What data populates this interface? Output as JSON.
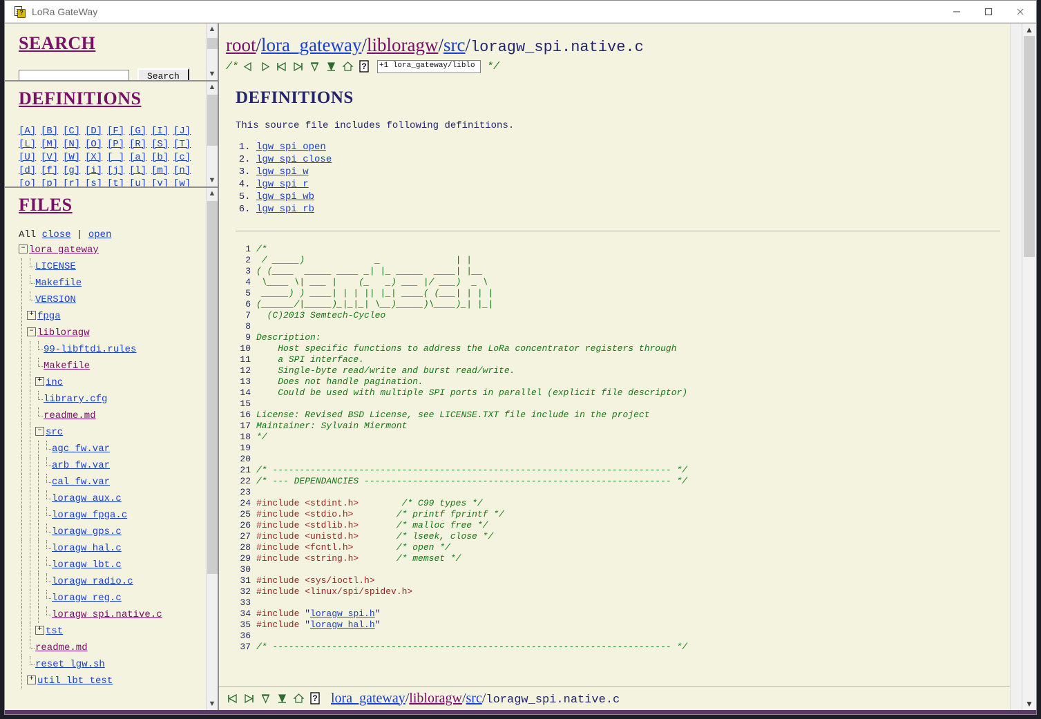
{
  "window": {
    "title": "LoRa GateWay",
    "icon": "document-question-icon",
    "minimize_label": "–",
    "maximize_label": "□",
    "close_label": "✕"
  },
  "search_panel": {
    "heading": "SEARCH",
    "input_value": "",
    "input_placeholder": "",
    "button_label": "Search"
  },
  "definitions_panel": {
    "heading": "DEFINITIONS",
    "alphabet_rows": [
      [
        "[A]",
        "[B]",
        "[C]",
        "[D]",
        "[F]",
        "[G]",
        "[I]",
        "[J]"
      ],
      [
        "[L]",
        "[M]",
        "[N]",
        "[O]",
        "[P]",
        "[R]",
        "[S]",
        "[T]"
      ],
      [
        "[U]",
        "[V]",
        "[W]",
        "[X]",
        "[_]",
        "[a]",
        "[b]",
        "[c]"
      ],
      [
        "[d]",
        "[f]",
        "[g]",
        "[i]",
        "[j]",
        "[l]",
        "[m]",
        "[n]"
      ],
      [
        "[o]",
        "[p]",
        "[r]",
        "[s]",
        "[t]",
        "[u]",
        "[v]",
        "[w]"
      ]
    ]
  },
  "files_panel": {
    "heading": "FILES",
    "all_label": "All",
    "close_label": "close",
    "separator": "|",
    "open_label": "open",
    "tree": [
      {
        "label": "lora_gateway",
        "depth": 0,
        "toggle": "minus",
        "visited": true
      },
      {
        "label": "LICENSE",
        "depth": 1,
        "toggle": "none",
        "visited": false
      },
      {
        "label": "Makefile",
        "depth": 1,
        "toggle": "none",
        "visited": false
      },
      {
        "label": "VERSION",
        "depth": 1,
        "toggle": "none",
        "visited": false
      },
      {
        "label": "fpga",
        "depth": 1,
        "toggle": "plus",
        "visited": false
      },
      {
        "label": "libloragw",
        "depth": 1,
        "toggle": "minus",
        "visited": true
      },
      {
        "label": "99-libftdi.rules",
        "depth": 2,
        "toggle": "none",
        "visited": false
      },
      {
        "label": "Makefile",
        "depth": 2,
        "toggle": "none",
        "visited": true
      },
      {
        "label": "inc",
        "depth": 2,
        "toggle": "plus",
        "visited": false
      },
      {
        "label": "library.cfg",
        "depth": 2,
        "toggle": "none",
        "visited": false
      },
      {
        "label": "readme.md",
        "depth": 2,
        "toggle": "none",
        "visited": true
      },
      {
        "label": "src",
        "depth": 2,
        "toggle": "minus",
        "visited": false
      },
      {
        "label": "agc_fw.var",
        "depth": 3,
        "toggle": "none",
        "visited": false
      },
      {
        "label": "arb_fw.var",
        "depth": 3,
        "toggle": "none",
        "visited": false
      },
      {
        "label": "cal_fw.var",
        "depth": 3,
        "toggle": "none",
        "visited": false
      },
      {
        "label": "loragw_aux.c",
        "depth": 3,
        "toggle": "none",
        "visited": false
      },
      {
        "label": "loragw_fpga.c",
        "depth": 3,
        "toggle": "none",
        "visited": false
      },
      {
        "label": "loragw_gps.c",
        "depth": 3,
        "toggle": "none",
        "visited": false
      },
      {
        "label": "loragw_hal.c",
        "depth": 3,
        "toggle": "none",
        "visited": false
      },
      {
        "label": "loragw_lbt.c",
        "depth": 3,
        "toggle": "none",
        "visited": false
      },
      {
        "label": "loragw_radio.c",
        "depth": 3,
        "toggle": "none",
        "visited": false
      },
      {
        "label": "loragw_reg.c",
        "depth": 3,
        "toggle": "none",
        "visited": false
      },
      {
        "label": "loragw_spi.native.c",
        "depth": 3,
        "toggle": "none",
        "visited": true
      },
      {
        "label": "tst",
        "depth": 2,
        "toggle": "plus",
        "visited": false
      },
      {
        "label": "readme.md",
        "depth": 1,
        "toggle": "none",
        "visited": true
      },
      {
        "label": "reset_lgw.sh",
        "depth": 1,
        "toggle": "none",
        "visited": false
      },
      {
        "label": "util_lbt_test",
        "depth": 1,
        "toggle": "plus",
        "visited": false
      }
    ]
  },
  "breadcrumb": {
    "parts": [
      {
        "text": "root",
        "link": true,
        "visited": true
      },
      {
        "text": "/",
        "link": false,
        "visited": false
      },
      {
        "text": "lora_gateway",
        "link": true,
        "visited": false
      },
      {
        "text": "/",
        "link": false,
        "visited": false
      },
      {
        "text": "libloragw",
        "link": true,
        "visited": true
      },
      {
        "text": "/",
        "link": false,
        "visited": false
      },
      {
        "text": "src",
        "link": true,
        "visited": false
      },
      {
        "text": "/",
        "link": false,
        "visited": false
      }
    ],
    "current": "loragw_spi.native.c"
  },
  "toolbar": {
    "open_comment": "/*",
    "close_comment": "*/",
    "icons": [
      "prev-triangle-icon",
      "next-triangle-icon",
      "first-icon",
      "last-icon",
      "top-icon",
      "bottom-icon",
      "home-icon",
      "help-icon"
    ],
    "quick_field_value": "+1 lora_gateway/liblo"
  },
  "main": {
    "heading": "DEFINITIONS",
    "intro": "This source file includes following definitions.",
    "definition_links": [
      "lgw_spi_open",
      "lgw_spi_close",
      "lgw_spi_w",
      "lgw_spi_r",
      "lgw_spi_wb",
      "lgw_spi_rb"
    ]
  },
  "code": {
    "start_line": 1,
    "lines": [
      {
        "n": 1,
        "segs": [
          {
            "t": "/*",
            "c": "cmt"
          }
        ]
      },
      {
        "n": 2,
        "segs": [
          {
            "t": " / _____)             _              | |",
            "c": "cmt"
          }
        ]
      },
      {
        "n": 3,
        "segs": [
          {
            "t": "( (____  _____ ____ _| |_ _____  ____| |__",
            "c": "cmt"
          }
        ]
      },
      {
        "n": 4,
        "segs": [
          {
            "t": " \\____ \\| ___ |    (_   _) ___ |/ ___)  _ \\",
            "c": "cmt"
          }
        ]
      },
      {
        "n": 5,
        "segs": [
          {
            "t": " _____) ) ____| | | || |_| ____( (___| | | |",
            "c": "cmt"
          }
        ]
      },
      {
        "n": 6,
        "segs": [
          {
            "t": "(______/|_____)_|_|_| \\__)_____)\\____)_| |_|",
            "c": "cmt"
          }
        ]
      },
      {
        "n": 7,
        "segs": [
          {
            "t": "  (C)2013 Semtech-Cycleo",
            "c": "cmt"
          }
        ]
      },
      {
        "n": 8,
        "segs": [
          {
            "t": "",
            "c": "cmt"
          }
        ]
      },
      {
        "n": 9,
        "segs": [
          {
            "t": "Description:",
            "c": "cmt"
          }
        ]
      },
      {
        "n": 10,
        "segs": [
          {
            "t": "    Host specific functions to address the LoRa concentrator registers through",
            "c": "cmt"
          }
        ]
      },
      {
        "n": 11,
        "segs": [
          {
            "t": "    a SPI interface.",
            "c": "cmt"
          }
        ]
      },
      {
        "n": 12,
        "segs": [
          {
            "t": "    Single-byte read/write and burst read/write.",
            "c": "cmt"
          }
        ]
      },
      {
        "n": 13,
        "segs": [
          {
            "t": "    Does not handle pagination.",
            "c": "cmt"
          }
        ]
      },
      {
        "n": 14,
        "segs": [
          {
            "t": "    Could be used with multiple SPI ports in parallel (explicit file descriptor)",
            "c": "cmt"
          }
        ]
      },
      {
        "n": 15,
        "segs": [
          {
            "t": "",
            "c": "cmt"
          }
        ]
      },
      {
        "n": 16,
        "segs": [
          {
            "t": "License: Revised BSD License, see LICENSE.TXT file include in the project",
            "c": "cmt"
          }
        ]
      },
      {
        "n": 17,
        "segs": [
          {
            "t": "Maintainer: Sylvain Miermont",
            "c": "cmt"
          }
        ]
      },
      {
        "n": 18,
        "segs": [
          {
            "t": "*/",
            "c": "cmt"
          }
        ]
      },
      {
        "n": 19,
        "segs": [
          {
            "t": "",
            "c": "cmt"
          }
        ]
      },
      {
        "n": 20,
        "segs": [
          {
            "t": "",
            "c": "cmt"
          }
        ]
      },
      {
        "n": 21,
        "segs": [
          {
            "t": "/* -------------------------------------------------------------------------- */",
            "c": "cmt"
          }
        ]
      },
      {
        "n": 22,
        "segs": [
          {
            "t": "/* --- DEPENDANCIES --------------------------------------------------------- */",
            "c": "cmt"
          }
        ]
      },
      {
        "n": 23,
        "segs": [
          {
            "t": "",
            "c": "cmt"
          }
        ]
      },
      {
        "n": 24,
        "segs": [
          {
            "t": "#include <stdint.h>",
            "c": "pre"
          },
          {
            "t": "        ",
            "c": "str"
          },
          {
            "t": "/* C99 types */",
            "c": "cmt"
          }
        ]
      },
      {
        "n": 25,
        "segs": [
          {
            "t": "#include <stdio.h>",
            "c": "pre"
          },
          {
            "t": "        ",
            "c": "str"
          },
          {
            "t": "/* printf fprintf */",
            "c": "cmt"
          }
        ]
      },
      {
        "n": 26,
        "segs": [
          {
            "t": "#include <stdlib.h>",
            "c": "pre"
          },
          {
            "t": "       ",
            "c": "str"
          },
          {
            "t": "/* malloc free */",
            "c": "cmt"
          }
        ]
      },
      {
        "n": 27,
        "segs": [
          {
            "t": "#include <unistd.h>",
            "c": "pre"
          },
          {
            "t": "       ",
            "c": "str"
          },
          {
            "t": "/* lseek, close */",
            "c": "cmt"
          }
        ]
      },
      {
        "n": 28,
        "segs": [
          {
            "t": "#include <fcntl.h>",
            "c": "pre"
          },
          {
            "t": "        ",
            "c": "str"
          },
          {
            "t": "/* open */",
            "c": "cmt"
          }
        ]
      },
      {
        "n": 29,
        "segs": [
          {
            "t": "#include <string.h>",
            "c": "pre"
          },
          {
            "t": "       ",
            "c": "str"
          },
          {
            "t": "/* memset */",
            "c": "cmt"
          }
        ]
      },
      {
        "n": 30,
        "segs": [
          {
            "t": "",
            "c": "cmt"
          }
        ]
      },
      {
        "n": 31,
        "segs": [
          {
            "t": "#include <sys/ioctl.h>",
            "c": "pre"
          }
        ]
      },
      {
        "n": 32,
        "segs": [
          {
            "t": "#include <linux/spi/spidev.h>",
            "c": "pre"
          }
        ]
      },
      {
        "n": 33,
        "segs": [
          {
            "t": "",
            "c": "cmt"
          }
        ]
      },
      {
        "n": 34,
        "segs": [
          {
            "t": "#include ",
            "c": "pre"
          },
          {
            "t": "\"",
            "c": "str"
          },
          {
            "t": "loragw_spi.h",
            "c": "link"
          },
          {
            "t": "\"",
            "c": "str"
          }
        ]
      },
      {
        "n": 35,
        "segs": [
          {
            "t": "#include ",
            "c": "pre"
          },
          {
            "t": "\"",
            "c": "str"
          },
          {
            "t": "loragw_hal.h",
            "c": "link"
          },
          {
            "t": "\"",
            "c": "str"
          }
        ]
      },
      {
        "n": 36,
        "segs": [
          {
            "t": "",
            "c": "cmt"
          }
        ]
      },
      {
        "n": 37,
        "segs": [
          {
            "t": "/* -------------------------------------------------------------------------- */",
            "c": "cmt"
          }
        ]
      }
    ]
  },
  "statusbar": {
    "icons": [
      "first-icon",
      "last-icon",
      "top-icon",
      "bottom-icon",
      "home-icon",
      "help-icon"
    ],
    "parts": [
      {
        "text": "lora_gateway",
        "link": true,
        "visited": false
      },
      {
        "text": "/",
        "link": false,
        "visited": false
      },
      {
        "text": "libloragw",
        "link": true,
        "visited": true
      },
      {
        "text": "/",
        "link": false,
        "visited": false
      },
      {
        "text": "src",
        "link": true,
        "visited": false
      },
      {
        "text": "/",
        "link": false,
        "visited": false
      }
    ],
    "current": "loragw_spi.native.c"
  },
  "colors": {
    "page_bg": "#f3f3df",
    "link": "#1a3fd4",
    "visited": "#7a0f68",
    "heading": "#24246e",
    "comment": "#127a12",
    "preproc": "#9a2020"
  }
}
